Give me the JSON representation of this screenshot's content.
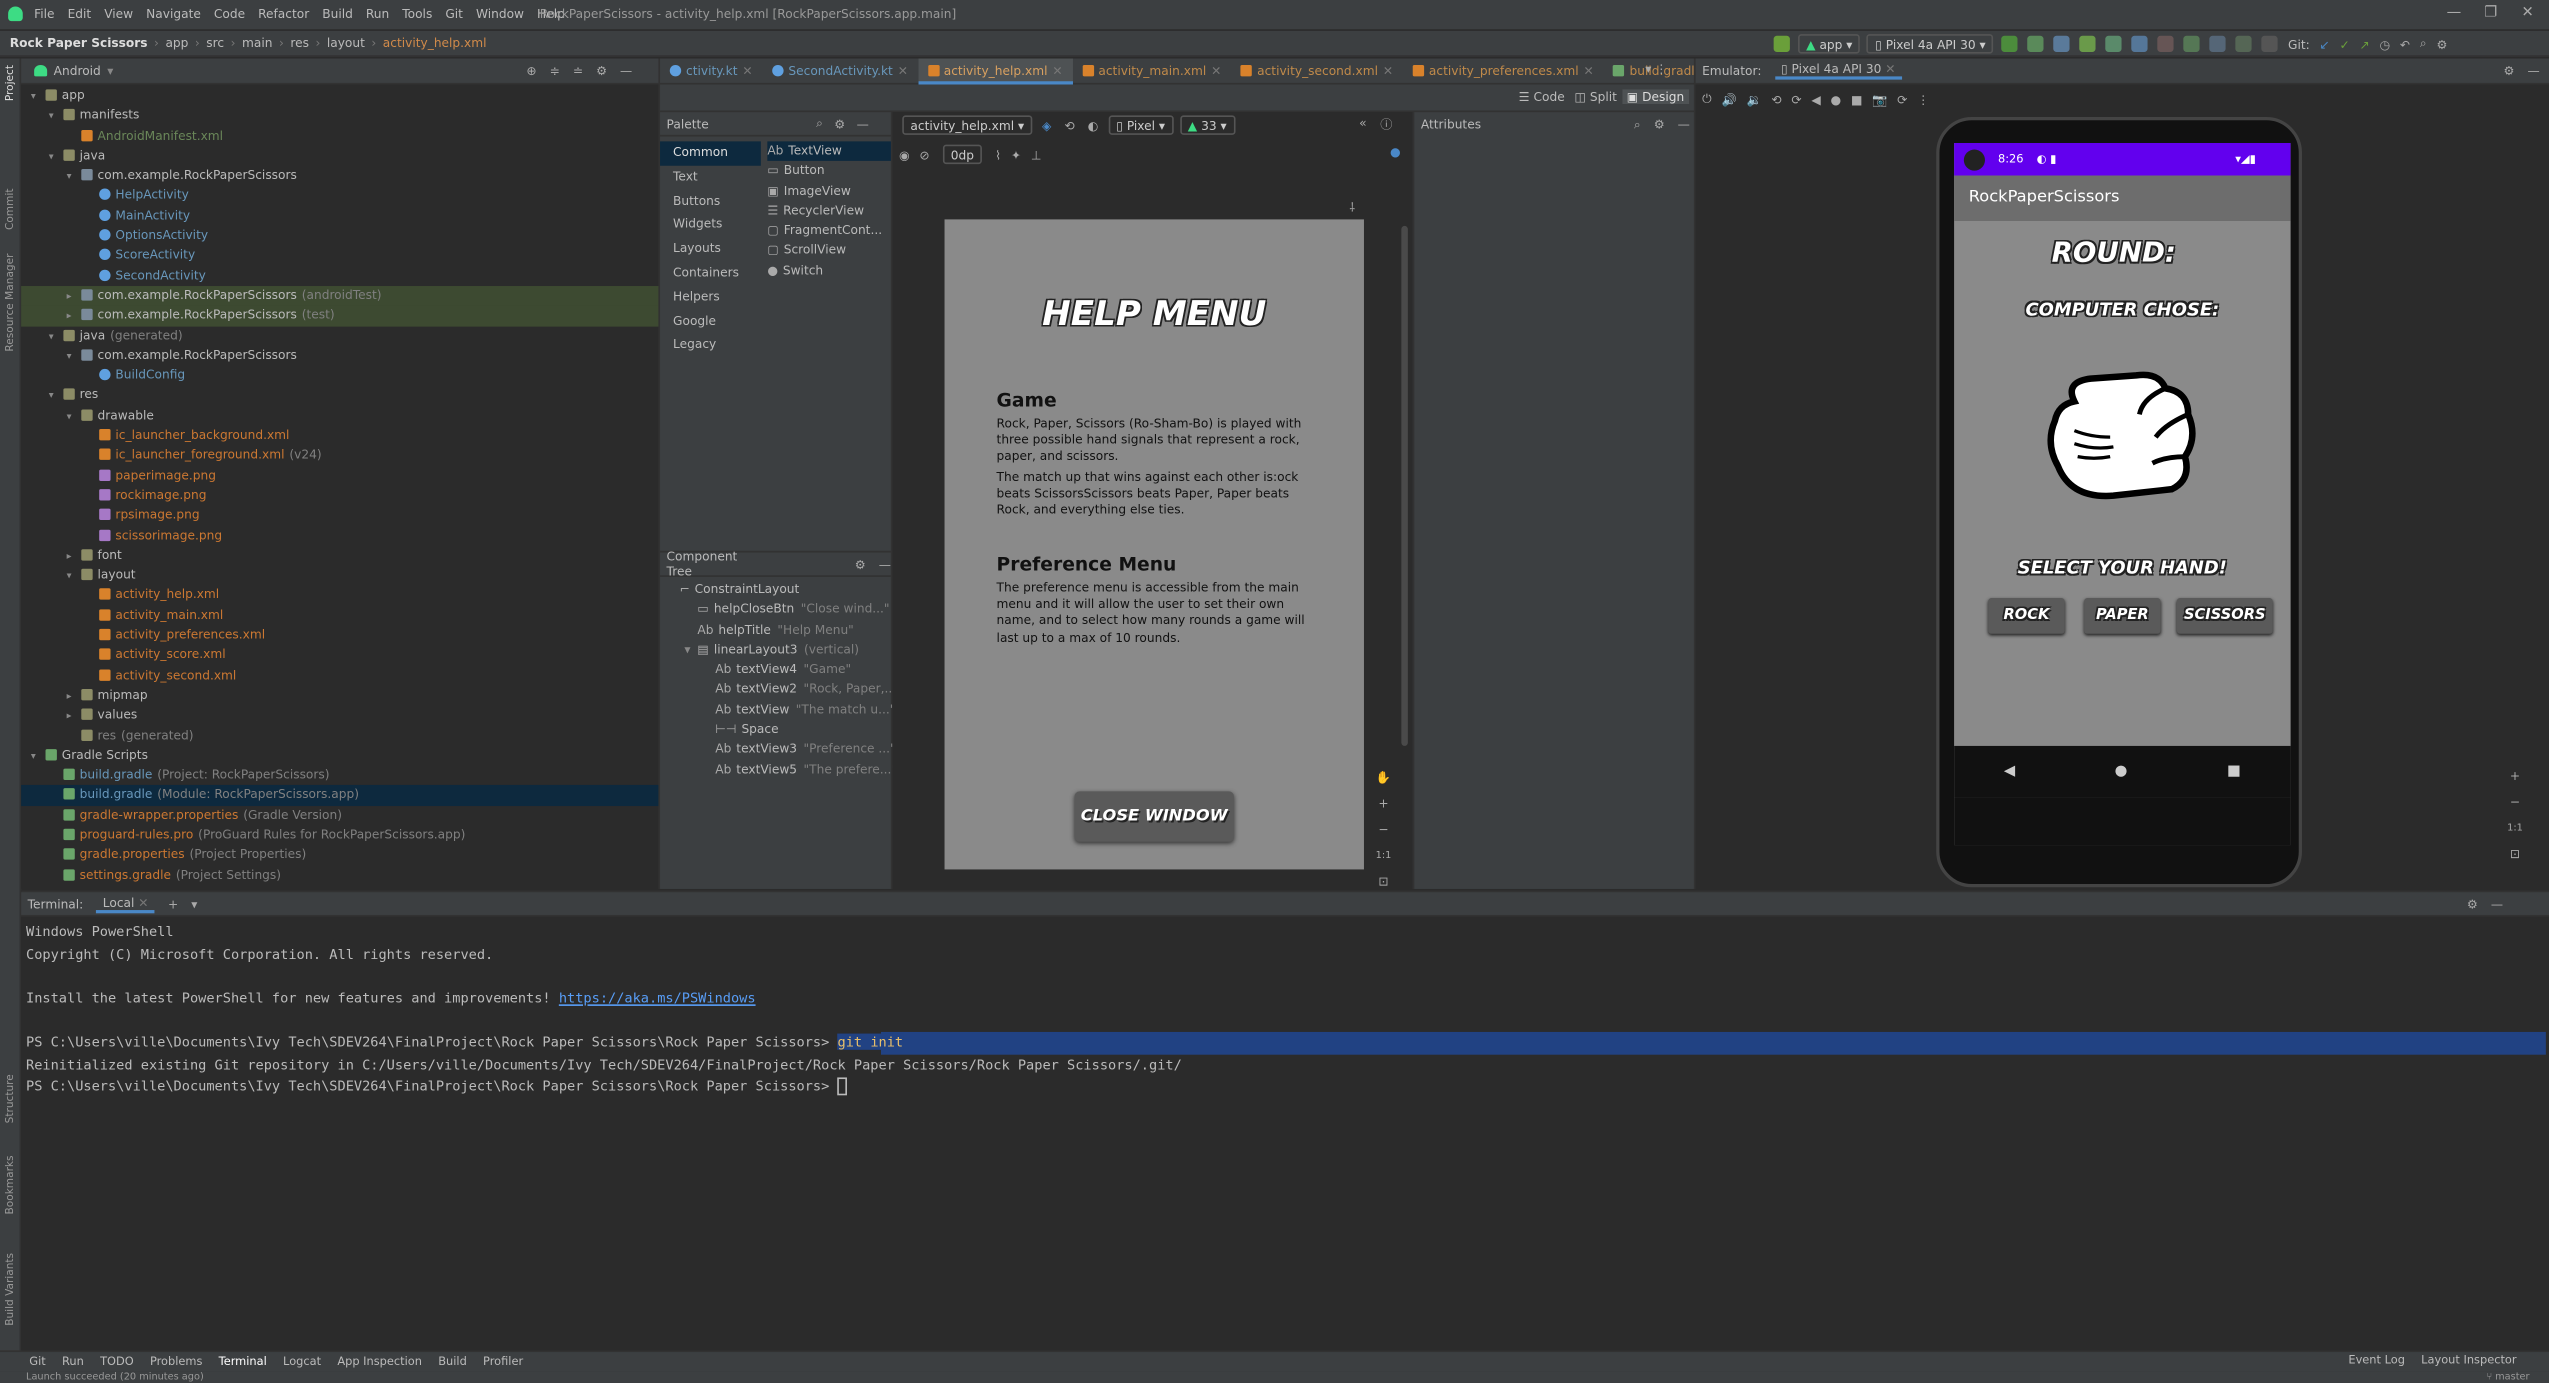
{
  "window": {
    "menu": [
      "File",
      "Edit",
      "View",
      "Navigate",
      "Code",
      "Refactor",
      "Build",
      "Run",
      "Tools",
      "Git",
      "Window",
      "Help"
    ],
    "title": "RockPaperScissors - activity_help.xml [RockPaperScissors.app.main]"
  },
  "breadcrumb": [
    "Rock Paper Scissors",
    "app",
    "src",
    "main",
    "res",
    "layout",
    "activity_help.xml"
  ],
  "toolbar": {
    "run_config": "app",
    "device": "Pixel 4a API 30",
    "git_label": "Git:"
  },
  "project": {
    "view_mode": "Android",
    "tree": [
      {
        "depth": 0,
        "arrow": "▾",
        "icon": "folder",
        "label": "app",
        "suffix": "",
        "color": ""
      },
      {
        "depth": 1,
        "arrow": "▾",
        "icon": "folder",
        "label": "manifests",
        "suffix": "",
        "color": ""
      },
      {
        "depth": 2,
        "arrow": "",
        "icon": "xml",
        "label": "AndroidManifest.xml",
        "suffix": "",
        "color": "c-green"
      },
      {
        "depth": 1,
        "arrow": "▾",
        "icon": "folder",
        "label": "java",
        "suffix": "",
        "color": ""
      },
      {
        "depth": 2,
        "arrow": "▾",
        "icon": "pkg",
        "label": "com.example.RockPaperScissors",
        "suffix": "",
        "color": ""
      },
      {
        "depth": 3,
        "arrow": "",
        "icon": "kt",
        "label": "HelpActivity",
        "suffix": "",
        "color": "c-blue"
      },
      {
        "depth": 3,
        "arrow": "",
        "icon": "kt",
        "label": "MainActivity",
        "suffix": "",
        "color": "c-blue"
      },
      {
        "depth": 3,
        "arrow": "",
        "icon": "kt",
        "label": "OptionsActivity",
        "suffix": "",
        "color": "c-blue"
      },
      {
        "depth": 3,
        "arrow": "",
        "icon": "kt",
        "label": "ScoreActivity",
        "suffix": "",
        "color": "c-blue"
      },
      {
        "depth": 3,
        "arrow": "",
        "icon": "kt",
        "label": "SecondActivity",
        "suffix": "",
        "color": "c-blue"
      },
      {
        "depth": 2,
        "arrow": "▸",
        "icon": "pkg",
        "label": "com.example.RockPaperScissors",
        "suffix": "(androidTest)",
        "color": "",
        "hl": true
      },
      {
        "depth": 2,
        "arrow": "▸",
        "icon": "pkg",
        "label": "com.example.RockPaperScissors",
        "suffix": "(test)",
        "color": "",
        "hl": true
      },
      {
        "depth": 1,
        "arrow": "▾",
        "icon": "folder",
        "label": "java",
        "suffix": "(generated)",
        "color": ""
      },
      {
        "depth": 2,
        "arrow": "▾",
        "icon": "pkg",
        "label": "com.example.RockPaperScissors",
        "suffix": "",
        "color": ""
      },
      {
        "depth": 3,
        "arrow": "",
        "icon": "kt",
        "label": "BuildConfig",
        "suffix": "",
        "color": "c-blue"
      },
      {
        "depth": 1,
        "arrow": "▾",
        "icon": "folder",
        "label": "res",
        "suffix": "",
        "color": ""
      },
      {
        "depth": 2,
        "arrow": "▾",
        "icon": "folder",
        "label": "drawable",
        "suffix": "",
        "color": ""
      },
      {
        "depth": 3,
        "arrow": "",
        "icon": "xml",
        "label": "ic_launcher_background.xml",
        "suffix": "",
        "color": "c-orange"
      },
      {
        "depth": 3,
        "arrow": "",
        "icon": "xml",
        "label": "ic_launcher_foreground.xml",
        "suffix": "(v24)",
        "color": "c-orange"
      },
      {
        "depth": 3,
        "arrow": "",
        "icon": "img",
        "label": "paperimage.png",
        "suffix": "",
        "color": "c-orange"
      },
      {
        "depth": 3,
        "arrow": "",
        "icon": "img",
        "label": "rockimage.png",
        "suffix": "",
        "color": "c-orange"
      },
      {
        "depth": 3,
        "arrow": "",
        "icon": "img",
        "label": "rpsimage.png",
        "suffix": "",
        "color": "c-orange"
      },
      {
        "depth": 3,
        "arrow": "",
        "icon": "img",
        "label": "scissorimage.png",
        "suffix": "",
        "color": "c-orange"
      },
      {
        "depth": 2,
        "arrow": "▸",
        "icon": "folder",
        "label": "font",
        "suffix": "",
        "color": ""
      },
      {
        "depth": 2,
        "arrow": "▾",
        "icon": "folder",
        "label": "layout",
        "suffix": "",
        "color": ""
      },
      {
        "depth": 3,
        "arrow": "",
        "icon": "xml",
        "label": "activity_help.xml",
        "suffix": "",
        "color": "c-orange"
      },
      {
        "depth": 3,
        "arrow": "",
        "icon": "xml",
        "label": "activity_main.xml",
        "suffix": "",
        "color": "c-orange"
      },
      {
        "depth": 3,
        "arrow": "",
        "icon": "xml",
        "label": "activity_preferences.xml",
        "suffix": "",
        "color": "c-orange"
      },
      {
        "depth": 3,
        "arrow": "",
        "icon": "xml",
        "label": "activity_score.xml",
        "suffix": "",
        "color": "c-orange"
      },
      {
        "depth": 3,
        "arrow": "",
        "icon": "xml",
        "label": "activity_second.xml",
        "suffix": "",
        "color": "c-orange"
      },
      {
        "depth": 2,
        "arrow": "▸",
        "icon": "folder",
        "label": "mipmap",
        "suffix": "",
        "color": ""
      },
      {
        "depth": 2,
        "arrow": "▸",
        "icon": "folder",
        "label": "values",
        "suffix": "",
        "color": ""
      },
      {
        "depth": 2,
        "arrow": "",
        "icon": "folder",
        "label": "res",
        "suffix": "(generated)",
        "color": "c-grey"
      },
      {
        "depth": 0,
        "arrow": "▾",
        "icon": "gradle",
        "label": "Gradle Scripts",
        "suffix": "",
        "color": ""
      },
      {
        "depth": 1,
        "arrow": "",
        "icon": "gradle",
        "label": "build.gradle",
        "suffix": "(Project: RockPaperScissors)",
        "color": "c-blue"
      },
      {
        "depth": 1,
        "arrow": "",
        "icon": "gradle",
        "label": "build.gradle",
        "suffix": "(Module: RockPaperScissors.app)",
        "color": "c-blue",
        "sel": true
      },
      {
        "depth": 1,
        "arrow": "",
        "icon": "gradle",
        "label": "gradle-wrapper.properties",
        "suffix": "(Gradle Version)",
        "color": "c-orange"
      },
      {
        "depth": 1,
        "arrow": "",
        "icon": "gradle",
        "label": "proguard-rules.pro",
        "suffix": "(ProGuard Rules for RockPaperScissors.app)",
        "color": "c-orange"
      },
      {
        "depth": 1,
        "arrow": "",
        "icon": "gradle",
        "label": "gradle.properties",
        "suffix": "(Project Properties)",
        "color": "c-orange"
      },
      {
        "depth": 1,
        "arrow": "",
        "icon": "gradle",
        "label": "settings.gradle",
        "suffix": "(Project Settings)",
        "color": "c-orange"
      }
    ]
  },
  "editor": {
    "tabs": [
      {
        "label": "ctivity.kt",
        "active": false
      },
      {
        "label": "SecondActivity.kt",
        "active": false
      },
      {
        "label": "activity_help.xml",
        "active": true
      },
      {
        "label": "activity_main.xml",
        "active": false
      },
      {
        "label": "activity_second.xml",
        "active": false
      },
      {
        "label": "activity_preferences.xml",
        "active": false
      },
      {
        "label": "build.gradle (:app)",
        "active": false
      }
    ],
    "view_modes": [
      "Code",
      "Split",
      "Design"
    ],
    "file_dropdown": "activity_help.xml",
    "device_dropdown": "Pixel",
    "api_dropdown": "33",
    "dp_field": "0dp",
    "palette": {
      "title": "Palette",
      "categories": [
        "Common",
        "Text",
        "Buttons",
        "Widgets",
        "Layouts",
        "Containers",
        "Helpers",
        "Google",
        "Legacy"
      ],
      "items": [
        {
          "prefix": "Ab",
          "label": "TextView"
        },
        {
          "prefix": "▭",
          "label": "Button"
        },
        {
          "prefix": "▣",
          "label": "ImageView"
        },
        {
          "prefix": "☰",
          "label": "RecyclerView"
        },
        {
          "prefix": "▢",
          "label": "FragmentCont..."
        },
        {
          "prefix": "▢",
          "label": "ScrollView"
        },
        {
          "prefix": "●",
          "label": "Switch"
        }
      ]
    },
    "component_tree": {
      "title": "Component Tree",
      "rows": [
        {
          "indent": 0,
          "icon": "⌐",
          "name": "ConstraintLayout",
          "hint": ""
        },
        {
          "indent": 1,
          "icon": "▭",
          "name": "helpCloseBtn",
          "hint": "\"Close wind...\""
        },
        {
          "indent": 1,
          "icon": "Ab",
          "name": "helpTitle",
          "hint": "\"Help Menu\""
        },
        {
          "indent": 1,
          "icon": "▤",
          "name": "linearLayout3",
          "hint": "(vertical)",
          "arrow": "▾"
        },
        {
          "indent": 2,
          "icon": "Ab",
          "name": "textView4",
          "hint": "\"Game\""
        },
        {
          "indent": 2,
          "icon": "Ab",
          "name": "textView2",
          "hint": "\"Rock, Paper,...\""
        },
        {
          "indent": 2,
          "icon": "Ab",
          "name": "textView",
          "hint": "\"The match u...\""
        },
        {
          "indent": 2,
          "icon": "⊢⊣",
          "name": "Space",
          "hint": ""
        },
        {
          "indent": 2,
          "icon": "Ab",
          "name": "textView3",
          "hint": "\"Preference ...\""
        },
        {
          "indent": 2,
          "icon": "Ab",
          "name": "textView5",
          "hint": "\"The prefere...\""
        }
      ]
    },
    "attributes_title": "Attributes",
    "preview": {
      "title": "HELP MENU",
      "game_heading": "Game",
      "game_text_1": "Rock, Paper, Scissors (Ro-Sham-Bo) is played with three possible hand signals that represent a rock, paper, and scissors.",
      "game_text_2": "The match up that wins against each other is:ock beats ScissorsScissors beats Paper, Paper beats Rock, and everything else ties.",
      "pref_heading": "Preference Menu",
      "pref_text": "The preference menu is accessible from the main menu and it will allow the user to set their own name, and to select how many rounds a game will last up to a max of 10 rounds.",
      "close_button": "CLOSE WINDOW"
    },
    "zoom_ratio": "1:1"
  },
  "emulator": {
    "label": "Emulator:",
    "device_tab": "Pixel 4a API 30",
    "status_time": "8:26",
    "app_title": "RockPaperScissors",
    "round_label": "ROUND:",
    "computer_chose": "COMPUTER CHOSE:",
    "select_hand": "SELECT YOUR HAND!",
    "buttons": [
      "ROCK",
      "PAPER",
      "SCISSORS"
    ],
    "zoom_ratio": "1:1",
    "accent_color": "#6200ee"
  },
  "terminal": {
    "title": "Terminal:",
    "tab": "Local",
    "lines": [
      {
        "text": "Windows PowerShell"
      },
      {
        "text": "Copyright (C) Microsoft Corporation. All rights reserved."
      },
      {
        "text": ""
      },
      {
        "text": "Install the latest PowerShell for new features and improvements! ",
        "link": "https://aka.ms/PSWindows"
      },
      {
        "text": ""
      },
      {
        "text": "PS C:\\Users\\ville\\Documents\\Ivy Tech\\SDEV264\\FinalProject\\Rock Paper Scissors\\Rock Paper Scissors> ",
        "cmd": "git init",
        "selected": true
      },
      {
        "text": "Reinitialized existing Git repository in C:/Users/ville/Documents/Ivy Tech/SDEV264/FinalProject/Rock Paper Scissors/Rock Paper Scissors/.git/"
      },
      {
        "text": "PS C:\\Users\\ville\\Documents\\Ivy Tech\\SDEV264\\FinalProject\\Rock Paper Scissors\\Rock Paper Scissors> ",
        "cursor": true
      }
    ]
  },
  "tool_windows": [
    "Git",
    "Run",
    "TODO",
    "Problems",
    "Terminal",
    "Logcat",
    "App Inspection",
    "Build",
    "Profiler"
  ],
  "tool_windows_right": [
    "Event Log",
    "Layout Inspector"
  ],
  "left_strip": [
    "Project",
    "Commit",
    "Resource Manager",
    "Structure",
    "Bookmarks",
    "Build Variants"
  ],
  "status": {
    "message": "Launch succeeded (20 minutes ago)",
    "branch": "master"
  }
}
